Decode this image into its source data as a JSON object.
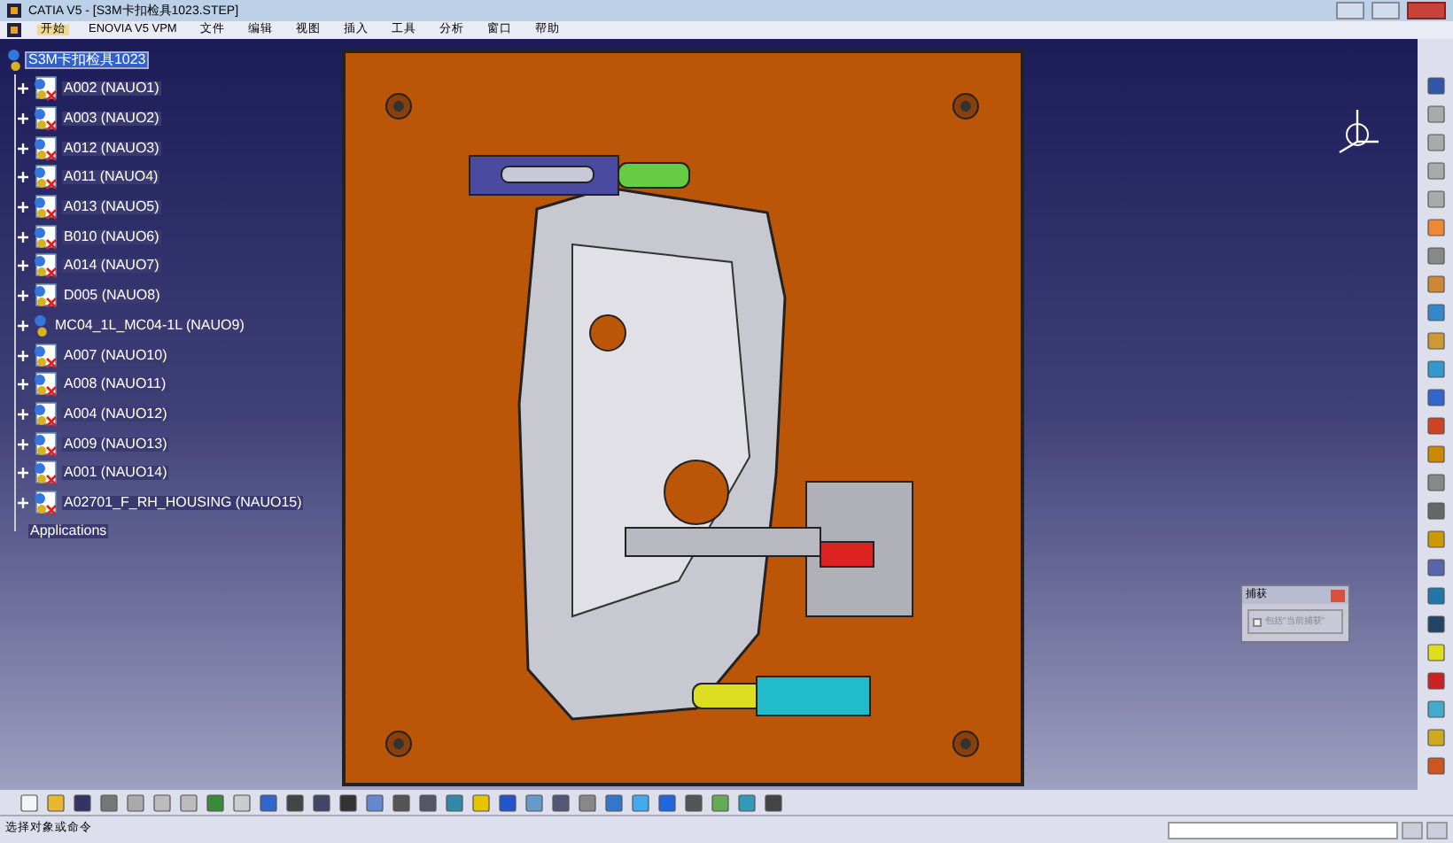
{
  "window": {
    "title": "CATIA V5 - [S3M卡扣检具1023.STEP]"
  },
  "menu": [
    {
      "label": "开始",
      "selected": true
    },
    {
      "label": "ENOVIA V5 VPM",
      "selected": false
    },
    {
      "label": "文件",
      "selected": false
    },
    {
      "label": "编辑",
      "selected": false
    },
    {
      "label": "视图",
      "selected": false
    },
    {
      "label": "插入",
      "selected": false
    },
    {
      "label": "工具",
      "selected": false
    },
    {
      "label": "分析",
      "selected": false
    },
    {
      "label": "窗口",
      "selected": false
    },
    {
      "label": "帮助",
      "selected": false
    }
  ],
  "tree": {
    "root": {
      "label": "S3M卡扣检具1023",
      "selected": true
    },
    "items": [
      {
        "label": "A002 (NAUO1)",
        "kind": "part"
      },
      {
        "label": "A003 (NAUO2)",
        "kind": "part"
      },
      {
        "label": "A012 (NAUO3)",
        "kind": "part"
      },
      {
        "label": "A011 (NAUO4)",
        "kind": "part"
      },
      {
        "label": "A013 (NAUO5)",
        "kind": "part"
      },
      {
        "label": "B010 (NAUO6)",
        "kind": "part"
      },
      {
        "label": "A014 (NAUO7)",
        "kind": "part"
      },
      {
        "label": "D005 (NAUO8)",
        "kind": "part"
      },
      {
        "label": "MC04_1L_MC04-1L (NAUO9)",
        "kind": "product"
      },
      {
        "label": "A007 (NAUO10)",
        "kind": "part"
      },
      {
        "label": "A008 (NAUO11)",
        "kind": "part"
      },
      {
        "label": "A004 (NAUO12)",
        "kind": "part"
      },
      {
        "label": "A009 (NAUO13)",
        "kind": "part"
      },
      {
        "label": "A001 (NAUO14)",
        "kind": "part"
      },
      {
        "label": "A02701_F_RH_HOUSING (NAUO15)",
        "kind": "part"
      }
    ],
    "footer": "Applications"
  },
  "dialog": {
    "title": "捕获",
    "checkbox": {
      "label": "包括\"当前捕获\"",
      "checked": false
    }
  },
  "status_bar": {
    "text": "选择对象或命令"
  }
}
